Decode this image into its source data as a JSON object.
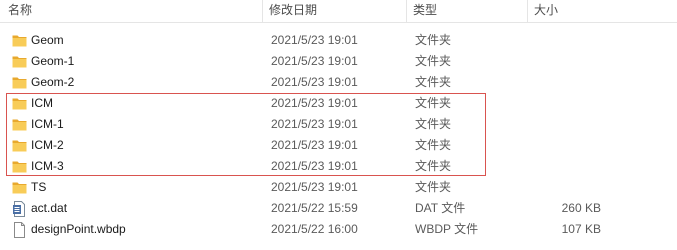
{
  "columns": {
    "name": "名称",
    "date": "修改日期",
    "type": "类型",
    "size": "大小"
  },
  "rows": [
    {
      "name": "Geom",
      "date": "2021/5/23 19:01",
      "type": "文件夹",
      "size": "",
      "icon": "folder-icon"
    },
    {
      "name": "Geom-1",
      "date": "2021/5/23 19:01",
      "type": "文件夹",
      "size": "",
      "icon": "folder-icon"
    },
    {
      "name": "Geom-2",
      "date": "2021/5/23 19:01",
      "type": "文件夹",
      "size": "",
      "icon": "folder-icon"
    },
    {
      "name": "ICM",
      "date": "2021/5/23 19:01",
      "type": "文件夹",
      "size": "",
      "icon": "folder-icon"
    },
    {
      "name": "ICM-1",
      "date": "2021/5/23 19:01",
      "type": "文件夹",
      "size": "",
      "icon": "folder-icon"
    },
    {
      "name": "ICM-2",
      "date": "2021/5/23 19:01",
      "type": "文件夹",
      "size": "",
      "icon": "folder-icon"
    },
    {
      "name": "ICM-3",
      "date": "2021/5/23 19:01",
      "type": "文件夹",
      "size": "",
      "icon": "folder-icon"
    },
    {
      "name": "TS",
      "date": "2021/5/23 19:01",
      "type": "文件夹",
      "size": "",
      "icon": "folder-icon"
    },
    {
      "name": "act.dat",
      "date": "2021/5/22 15:59",
      "type": "DAT 文件",
      "size": "260 KB",
      "icon": "dat-file-icon"
    },
    {
      "name": "designPoint.wbdp",
      "date": "2021/5/22 16:00",
      "type": "WBDP 文件",
      "size": "107 KB",
      "icon": "generic-file-icon"
    }
  ],
  "colors": {
    "folder": "#f5c242",
    "highlight_border": "#d9534f"
  }
}
